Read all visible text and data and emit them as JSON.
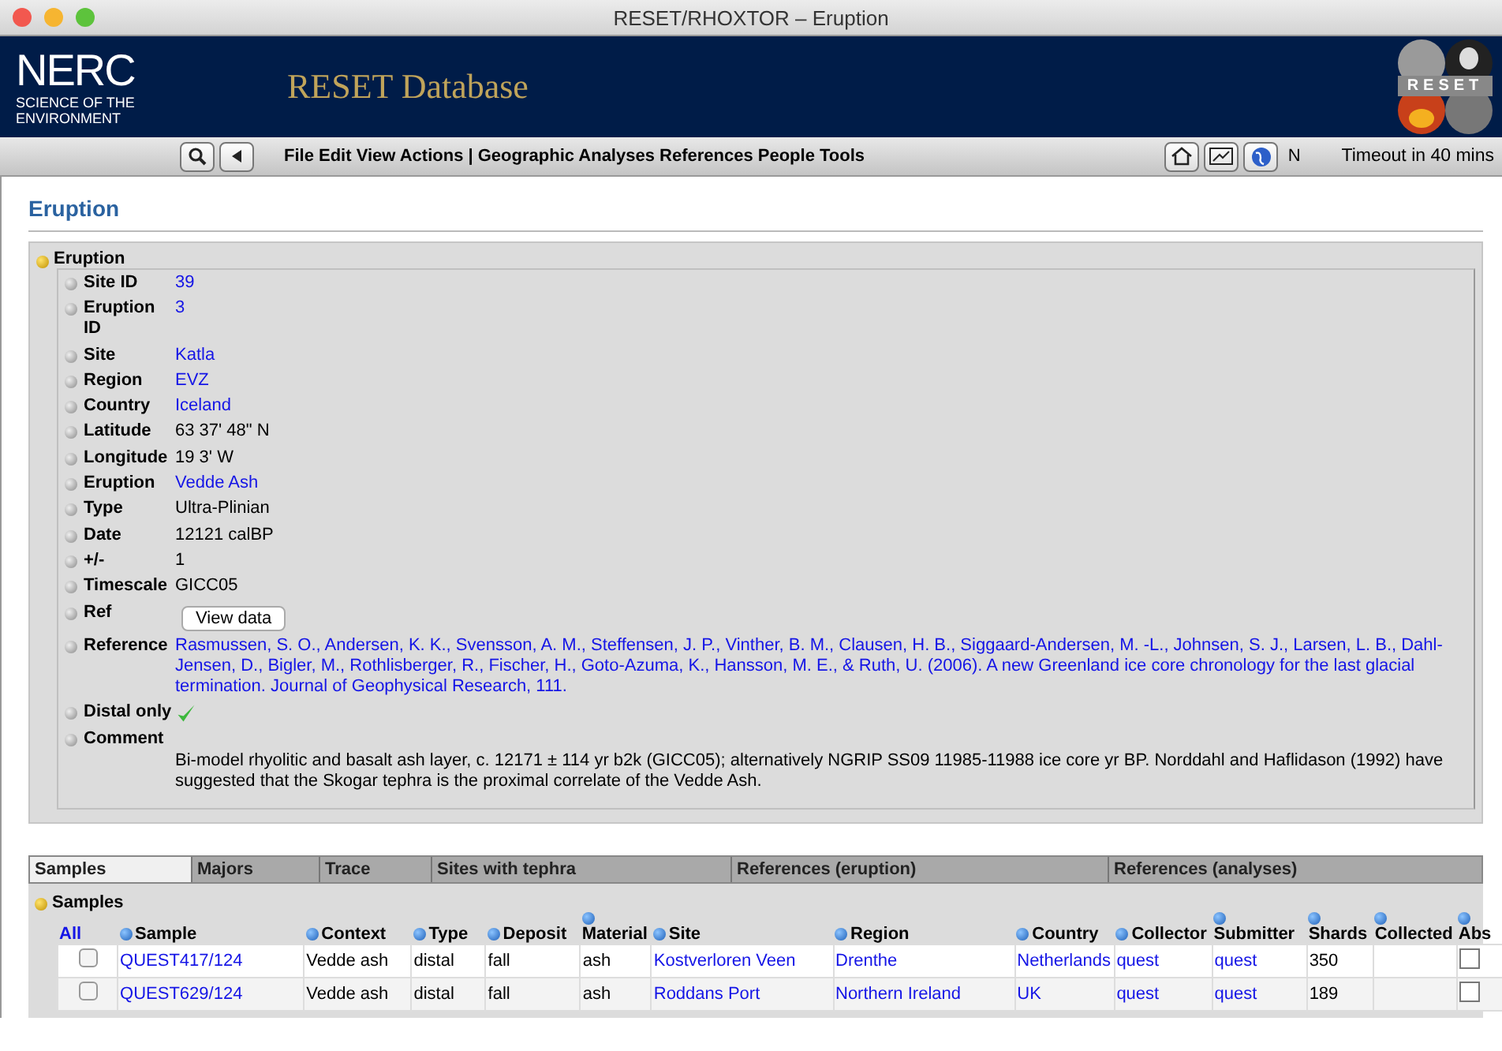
{
  "window": {
    "title": "RESET/RHOXTOR – Eruption"
  },
  "header": {
    "org_name": "NERC",
    "org_tagline": "SCIENCE OF THE ENVIRONMENT",
    "title": "RESET Database",
    "logo_text": "RESET"
  },
  "toolbar": {
    "menu": "File Edit View Actions | Geographic Analyses References People Tools",
    "n_label": "N",
    "timeout": "Timeout in 40 mins"
  },
  "page_title": "Eruption",
  "eruption": {
    "heading": "Eruption",
    "fields": [
      {
        "label": "Site ID",
        "kind": "link",
        "value": "39"
      },
      {
        "label": "Eruption ID",
        "kind": "link",
        "value": "3"
      },
      {
        "label": "Site",
        "kind": "link",
        "value": "Katla"
      },
      {
        "label": "Region",
        "kind": "link",
        "value": "EVZ"
      },
      {
        "label": "Country",
        "kind": "link",
        "value": "Iceland"
      },
      {
        "label": "Latitude",
        "kind": "text",
        "value": "63 37' 48\" N"
      },
      {
        "label": "Longitude",
        "kind": "text",
        "value": "19 3' W"
      },
      {
        "label": "Eruption",
        "kind": "link",
        "value": "Vedde Ash"
      },
      {
        "label": "Type",
        "kind": "text",
        "value": "Ultra-Plinian"
      },
      {
        "label": "Date",
        "kind": "text",
        "value": "12121 calBP"
      },
      {
        "label": "+/-",
        "kind": "text",
        "value": "1"
      },
      {
        "label": "Timescale",
        "kind": "text",
        "value": "GICC05"
      },
      {
        "label": "Ref",
        "kind": "button",
        "value": "View data"
      },
      {
        "label": "Reference",
        "kind": "link",
        "value": "Rasmussen, S. O., Andersen, K. K., Svensson, A. M., Steffensen, J. P., Vinther, B. M., Clausen, H. B., Siggaard-Andersen, M. -L., Johnsen, S. J., Larsen, L. B., Dahl-Jensen, D., Bigler, M., Rothlisberger, R., Fischer, H., Goto-Azuma, K., Hansson, M. E., & Ruth, U. (2006). A new Greenland ice core chronology for the last glacial termination. Journal of Geophysical Research, 111."
      },
      {
        "label": "Distal only",
        "kind": "check",
        "checked": true
      },
      {
        "label": "Comment",
        "kind": "comment",
        "value": "Bi-model rhyolitic and basalt ash layer, c. 12171 ± 114 yr b2k (GICC05); alternatively NGRIP SS09 11985-11988 ice core yr BP. Norddahl and Haflidason (1992) have suggested that the Skogar tephra is the proximal correlate of the Vedde Ash."
      }
    ]
  },
  "tabs": [
    {
      "label": "Samples",
      "selected": true
    },
    {
      "label": "Majors",
      "selected": false
    },
    {
      "label": "Trace",
      "selected": false
    },
    {
      "label": "Sites with tephra",
      "selected": false
    },
    {
      "label": "References (eruption)",
      "selected": false
    },
    {
      "label": "References (analyses)",
      "selected": false
    }
  ],
  "samples": {
    "heading": "Samples",
    "all_link": "All",
    "columns": [
      {
        "label": "Sample",
        "stacked": false
      },
      {
        "label": "Context",
        "stacked": false
      },
      {
        "label": "Type",
        "stacked": false
      },
      {
        "label": "Deposit",
        "stacked": false
      },
      {
        "label": "Material",
        "stacked": true
      },
      {
        "label": "Site",
        "stacked": false
      },
      {
        "label": "Region",
        "stacked": false
      },
      {
        "label": "Country",
        "stacked": false
      },
      {
        "label": "Collector",
        "stacked": false
      },
      {
        "label": "Submitter",
        "stacked": true
      },
      {
        "label": "Shards",
        "stacked": true
      },
      {
        "label": "Collected",
        "stacked": true
      },
      {
        "label": "Abs",
        "stacked": true
      }
    ],
    "rows": [
      {
        "selected": false,
        "abs": false,
        "cells": [
          {
            "text": "QUEST417/124",
            "link": true
          },
          {
            "text": "Vedde ash",
            "link": false
          },
          {
            "text": "distal",
            "link": false
          },
          {
            "text": "fall",
            "link": false
          },
          {
            "text": "ash",
            "link": false
          },
          {
            "text": "Kostverloren Veen",
            "link": true
          },
          {
            "text": "Drenthe",
            "link": true
          },
          {
            "text": "Netherlands",
            "link": true
          },
          {
            "text": "quest",
            "link": true
          },
          {
            "text": "quest",
            "link": true
          },
          {
            "text": "350",
            "link": false
          }
        ]
      },
      {
        "selected": false,
        "abs": false,
        "cells": [
          {
            "text": "QUEST629/124",
            "link": true
          },
          {
            "text": "Vedde ash",
            "link": false
          },
          {
            "text": "distal",
            "link": false
          },
          {
            "text": "fall",
            "link": false
          },
          {
            "text": "ash",
            "link": false
          },
          {
            "text": "Roddans Port",
            "link": true
          },
          {
            "text": "Northern Ireland",
            "link": true
          },
          {
            "text": "UK",
            "link": true
          },
          {
            "text": "quest",
            "link": true
          },
          {
            "text": "quest",
            "link": true
          },
          {
            "text": "189",
            "link": false
          }
        ]
      }
    ]
  }
}
